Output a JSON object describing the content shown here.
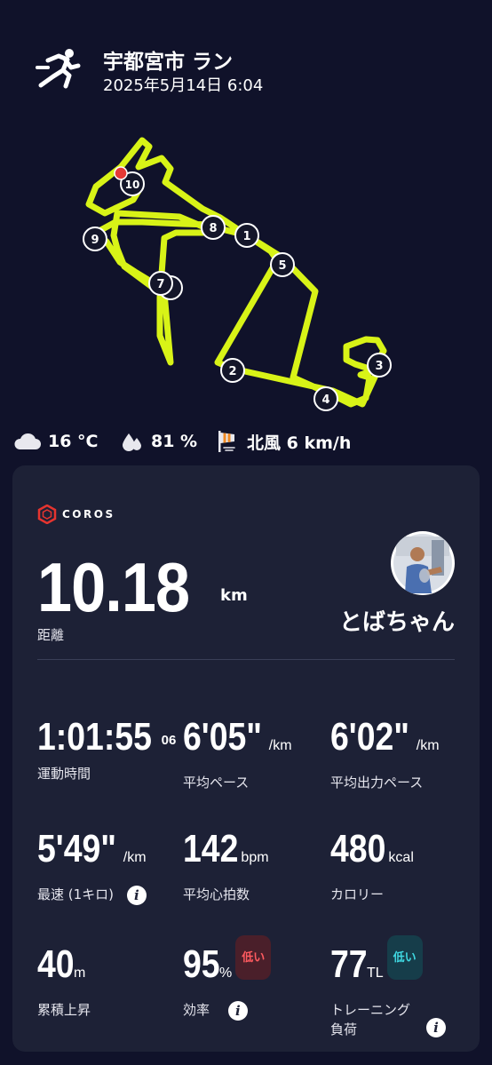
{
  "header": {
    "title": "宇都宮市 ラン",
    "datetime": "2025年5月14日 6:04",
    "activity_icon": "running-person-icon"
  },
  "map": {
    "route_color": "#d8f317",
    "start_marker_color": "#e53935",
    "km_markers": [
      "1",
      "2",
      "3",
      "4",
      "5",
      "7",
      "8",
      "9",
      "10"
    ]
  },
  "weather": {
    "temperature": "16 °C",
    "humidity": "81 %",
    "wind": "北風 6 km/h"
  },
  "card": {
    "brand": "COROS",
    "distance": {
      "value": "10.18",
      "unit": "km",
      "label": "距離"
    },
    "user": {
      "name": "とばちゃん"
    },
    "stats": [
      {
        "value": "1:01:55",
        "sup": "06",
        "unit": "",
        "label": "運動時間"
      },
      {
        "value": "6'05\"",
        "unit": "/km",
        "label": "平均ペース"
      },
      {
        "value": "6'02\"",
        "unit": "/km",
        "label": "平均出力ペース"
      },
      {
        "value": "5'49\"",
        "unit": "/km",
        "label": "最速 (1キロ)"
      },
      {
        "value": "142",
        "unit": "bpm",
        "label": "平均心拍数"
      },
      {
        "value": "480",
        "unit": "kcal",
        "label": "カロリー"
      },
      {
        "value": "40",
        "unit": "m",
        "label": "累積上昇"
      },
      {
        "value": "95",
        "unit": "%",
        "label": "効率",
        "badge": "低い"
      },
      {
        "value": "77",
        "unit": "TL",
        "label": "トレーニング",
        "label2": "負荷",
        "badge": "低い"
      }
    ],
    "info_glyph": "i"
  }
}
